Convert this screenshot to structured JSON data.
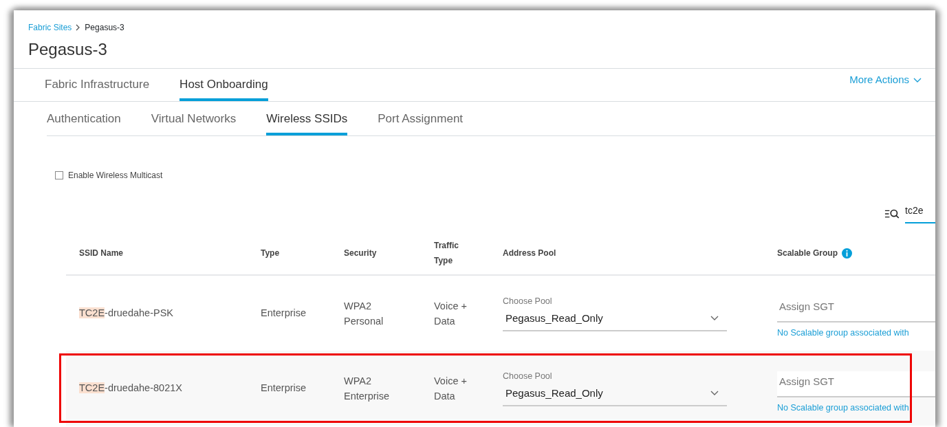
{
  "breadcrumb": [
    {
      "label": "Fabric Sites",
      "link": true
    },
    {
      "label": "Pegasus-3",
      "link": false
    }
  ],
  "page_title": "Pegasus-3",
  "tabs": [
    {
      "label": "Fabric Infrastructure",
      "selected": false
    },
    {
      "label": "Host Onboarding",
      "selected": true
    }
  ],
  "more_actions": "More Actions",
  "subtabs": [
    {
      "label": "Authentication",
      "selected": false
    },
    {
      "label": "Virtual Networks",
      "selected": false
    },
    {
      "label": "Wireless SSIDs",
      "selected": true
    },
    {
      "label": "Port Assignment",
      "selected": false
    }
  ],
  "multicast": {
    "label": "Enable Wireless Multicast",
    "checked": false
  },
  "search": {
    "value": "tc2e"
  },
  "table": {
    "columns": [
      {
        "label": "SSID Name",
        "info": false
      },
      {
        "label": "Type",
        "info": false
      },
      {
        "label": "Security",
        "info": false
      },
      {
        "label": "Traffic Type",
        "info": false
      },
      {
        "label": "Address Pool",
        "info": false
      },
      {
        "label": "Scalable Group",
        "info": true
      }
    ],
    "rows": [
      {
        "ssid_match": "TC2E",
        "ssid_rest": "-druedahe-PSK",
        "type": "Enterprise",
        "security": "WPA2 Personal",
        "traffic_type": "Voice + Data",
        "pool_label": "Choose Pool",
        "pool": "Pegasus_Read_Only",
        "sgt_placeholder": "Assign SGT",
        "sgt_note": "No Scalable group associated with",
        "highlighted": false
      },
      {
        "ssid_match": "TC2E",
        "ssid_rest": "-druedahe-8021X",
        "type": "Enterprise",
        "security": "WPA2 Enterprise",
        "traffic_type": "Voice + Data",
        "pool_label": "Choose Pool",
        "pool": "Pegasus_Read_Only",
        "sgt_placeholder": "Assign SGT",
        "sgt_note": "No Scalable group associated with",
        "highlighted": true
      }
    ]
  }
}
